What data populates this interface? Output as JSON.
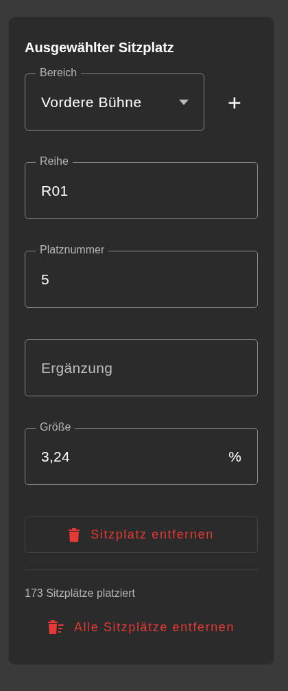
{
  "panel": {
    "title": "Ausgewählter Sitzplatz",
    "fields": [
      {
        "kind": "select",
        "label": "Bereich",
        "value": "Vordere Bühne",
        "add_button": "+"
      },
      {
        "kind": "text",
        "label": "Reihe",
        "value": "R01"
      },
      {
        "kind": "text",
        "label": "Platznummer",
        "value": "5"
      },
      {
        "kind": "text",
        "placeholder": "Ergänzung"
      },
      {
        "kind": "text",
        "label": "Größe",
        "value": "3,24",
        "suffix": "%"
      }
    ],
    "remove_button": "Sitzplatz entfernen",
    "count_text": "173 Sitzplätze platziert",
    "remove_all_button": "Alle Sitzplätze entfernen"
  }
}
